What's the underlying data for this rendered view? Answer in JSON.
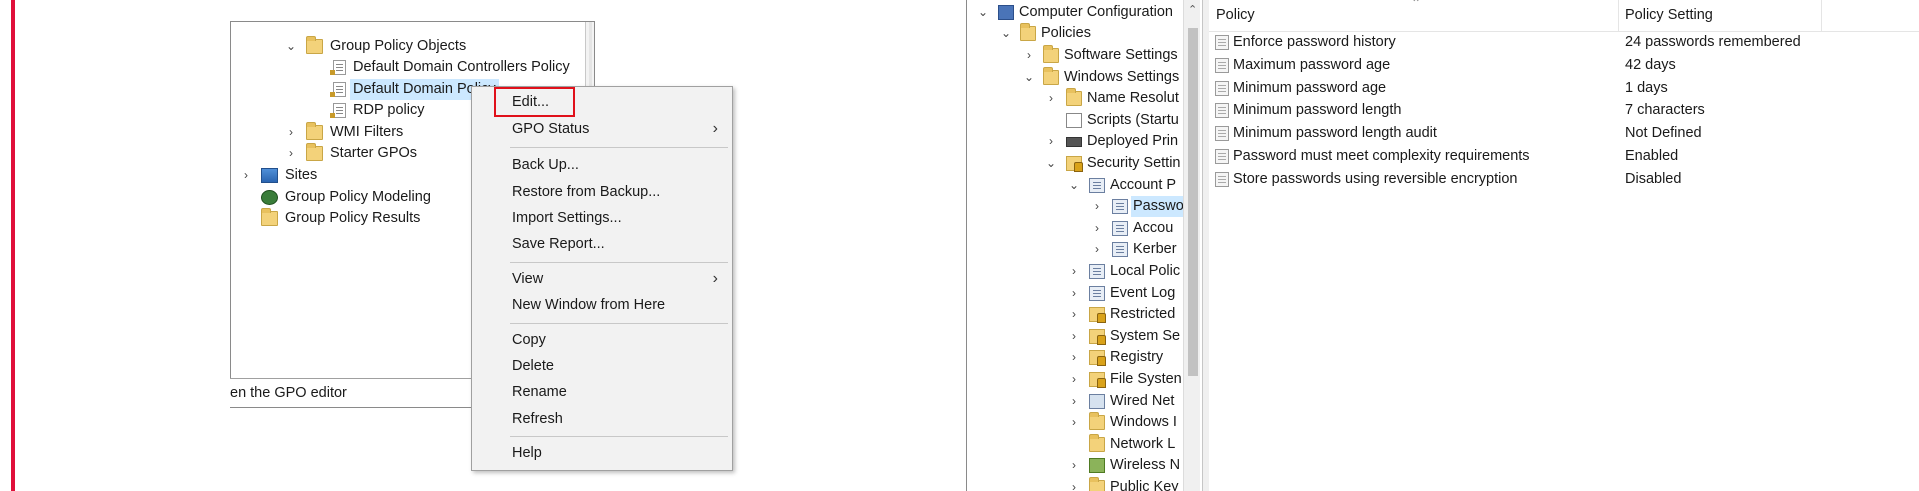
{
  "gpmc": {
    "tree": [
      {
        "label": "Group Policy Objects",
        "expanded": true,
        "icon": "folder-icon"
      },
      {
        "label": "Default Domain Controllers Policy",
        "icon": "gpo-icon"
      },
      {
        "label": "Default Domain Policy",
        "icon": "gpo-icon",
        "selected": true
      },
      {
        "label": "RDP policy",
        "icon": "gpo-icon"
      },
      {
        "label": "WMI Filters",
        "expanded": false,
        "icon": "folder-icon"
      },
      {
        "label": "Starter GPOs",
        "expanded": false,
        "icon": "folder-icon"
      },
      {
        "label": "Sites",
        "expanded": false,
        "icon": "sites-icon"
      },
      {
        "label": "Group Policy Modeling",
        "icon": "modeling-icon"
      },
      {
        "label": "Group Policy Results",
        "icon": "results-icon"
      }
    ],
    "status_text": "en the GPO editor"
  },
  "context_menu": {
    "items": [
      {
        "label": "Edit...",
        "highlighted": true
      },
      {
        "label": "GPO Status",
        "submenu": true
      },
      {
        "label": "Back Up..."
      },
      {
        "label": "Restore from Backup..."
      },
      {
        "label": "Import Settings..."
      },
      {
        "label": "Save Report..."
      },
      {
        "label": "View",
        "submenu": true
      },
      {
        "label": "New Window from Here"
      },
      {
        "label": "Copy"
      },
      {
        "label": "Delete"
      },
      {
        "label": "Rename"
      },
      {
        "label": "Refresh"
      },
      {
        "label": "Help"
      }
    ]
  },
  "gpme": {
    "tree": [
      {
        "label": "Computer Configuration",
        "expanded": true,
        "icon": "computer-icon"
      },
      {
        "label": "Policies",
        "expanded": true,
        "icon": "folder-icon"
      },
      {
        "label": "Software Settings",
        "expanded": false,
        "icon": "folder-icon"
      },
      {
        "label": "Windows Settings",
        "expanded": true,
        "icon": "folder-icon"
      },
      {
        "label": "Name Resolut",
        "expanded": false,
        "icon": "folder-icon"
      },
      {
        "label": "Scripts (Startu",
        "icon": "script-icon"
      },
      {
        "label": "Deployed Prin",
        "expanded": false,
        "icon": "printer-icon"
      },
      {
        "label": "Security Settin",
        "expanded": true,
        "icon": "security-icon"
      },
      {
        "label": "Account P",
        "expanded": true,
        "icon": "policy-book-icon"
      },
      {
        "label": "Passwo",
        "expanded": false,
        "icon": "policy-book-icon",
        "selected": true
      },
      {
        "label": "Accou",
        "expanded": false,
        "icon": "policy-book-icon"
      },
      {
        "label": "Kerber",
        "expanded": false,
        "icon": "policy-book-icon"
      },
      {
        "label": "Local Polic",
        "expanded": false,
        "icon": "policy-book-icon"
      },
      {
        "label": "Event Log",
        "expanded": false,
        "icon": "policy-book-icon"
      },
      {
        "label": "Restricted",
        "expanded": false,
        "icon": "security-icon"
      },
      {
        "label": "System Se",
        "expanded": false,
        "icon": "security-icon"
      },
      {
        "label": "Registry",
        "expanded": false,
        "icon": "security-icon"
      },
      {
        "label": "File Systen",
        "expanded": false,
        "icon": "security-icon"
      },
      {
        "label": "Wired Net",
        "expanded": false,
        "icon": "wired-network-icon"
      },
      {
        "label": "Windows I",
        "expanded": false,
        "icon": "folder-icon"
      },
      {
        "label": "Network L",
        "icon": "folder-icon"
      },
      {
        "label": "Wireless N",
        "expanded": false,
        "icon": "wireless-icon"
      },
      {
        "label": "Public Key",
        "expanded": false,
        "icon": "folder-icon"
      }
    ],
    "columns": {
      "policy": "Policy",
      "setting": "Policy Setting"
    },
    "rows": [
      {
        "policy": "Enforce password history",
        "setting": "24 passwords remembered"
      },
      {
        "policy": "Maximum password age",
        "setting": "42 days"
      },
      {
        "policy": "Minimum password age",
        "setting": "1 days"
      },
      {
        "policy": "Minimum password length",
        "setting": "7 characters"
      },
      {
        "policy": "Minimum password length audit",
        "setting": "Not Defined"
      },
      {
        "policy": "Password must meet complexity requirements",
        "setting": "Enabled"
      },
      {
        "policy": "Store passwords using reversible encryption",
        "setting": "Disabled"
      }
    ]
  },
  "colors": {
    "accent": "#e0103a",
    "highlight_box": "#e0101a",
    "selection": "#cce8ff"
  }
}
